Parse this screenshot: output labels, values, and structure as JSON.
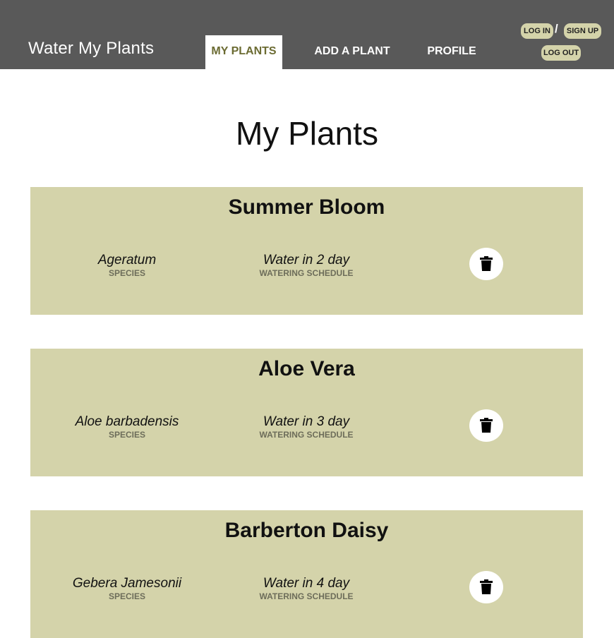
{
  "header": {
    "brand": "Water My Plants",
    "nav": [
      {
        "label": "MY PLANTS",
        "active": true
      },
      {
        "label": "ADD A PLANT",
        "active": false
      },
      {
        "label": "PROFILE",
        "active": false
      }
    ],
    "auth": {
      "login_label": "LOG IN",
      "separator": "/",
      "signup_label": "SIGN UP",
      "logout_label": "LOG OUT"
    }
  },
  "main": {
    "title": "My Plants",
    "species_label": "SPECIES",
    "schedule_label": "WATERING SCHEDULE",
    "delete_icon": "trash-icon",
    "plants": [
      {
        "name": "Summer Bloom",
        "species": "Ageratum",
        "schedule": "Water in 2 day"
      },
      {
        "name": "Aloe Vera",
        "species": "Aloe barbadensis",
        "schedule": "Water in 3 day"
      },
      {
        "name": "Barberton Daisy",
        "species": "Gebera Jamesonii",
        "schedule": "Water in 4 day"
      }
    ]
  },
  "colors": {
    "header_bg": "#595959",
    "card_bg": "#d4d3aa",
    "active_tab_text": "#6b6b32"
  }
}
